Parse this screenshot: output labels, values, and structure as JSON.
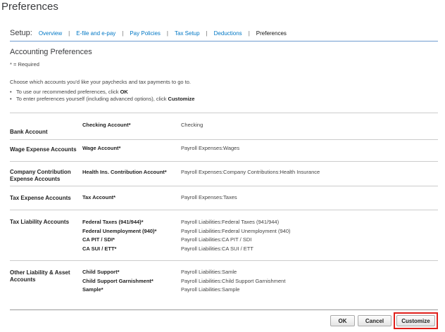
{
  "page": {
    "title": "Preferences"
  },
  "setup": {
    "label": "Setup:",
    "links": [
      "Overview",
      "E-file and e-pay",
      "Pay Policies",
      "Tax Setup",
      "Deductions"
    ],
    "current": "Preferences"
  },
  "section": {
    "title": "Accounting Preferences",
    "required_note": "* = Required",
    "intro": "Choose which accounts you'd like your paychecks and tax payments to go to.",
    "bullet1_text": "To use our recommended preferences, click ",
    "bullet1_bold": "OK",
    "bullet2_text": "To enter preferences yourself (including advanced options), click ",
    "bullet2_bold": "Customize"
  },
  "rows": [
    {
      "label": "Bank Account",
      "fields": [
        {
          "name": "Checking Account*",
          "value": "Checking"
        }
      ]
    },
    {
      "label": "Wage Expense Accounts",
      "fields": [
        {
          "name": "Wage Account*",
          "value": "Payroll Expenses:Wages"
        }
      ]
    },
    {
      "label": "Company Contribution Expense Accounts",
      "fields": [
        {
          "name": "Health Ins. Contribution Account*",
          "value": "Payroll Expenses:Company Contributions:Health Insurance"
        }
      ]
    },
    {
      "label": "Tax Expense Accounts",
      "fields": [
        {
          "name": "Tax Account*",
          "value": "Payroll Expenses:Taxes"
        }
      ]
    },
    {
      "label": "Tax Liability Accounts",
      "fields": [
        {
          "name": "Federal Taxes (941/944)*",
          "value": "Payroll Liabilities:Federal Taxes (941/944)"
        },
        {
          "name": "Federal Unemployment (940)*",
          "value": "Payroll Liabilities:Federal Unemployment (940)"
        },
        {
          "name": "CA PIT / SDI*",
          "value": "Payroll Liabilities:CA PIT / SDI"
        },
        {
          "name": "CA SUI / ETT*",
          "value": "Payroll Liabilities:CA SUI / ETT"
        }
      ]
    },
    {
      "label": "Other Liability & Asset Accounts",
      "fields": [
        {
          "name": "Child Support*",
          "value": "Payroll Liabilities:Samle"
        },
        {
          "name": "Child Support Garnishment*",
          "value": "Payroll Liabilities:Child Support Garnishment"
        },
        {
          "name": "Sample*",
          "value": "Payroll Liabilities:Sample"
        }
      ]
    }
  ],
  "buttons": {
    "ok": "OK",
    "cancel": "Cancel",
    "customize": "Customize"
  },
  "colors": {
    "link": "#0077c5",
    "highlight": "#e0201b"
  }
}
